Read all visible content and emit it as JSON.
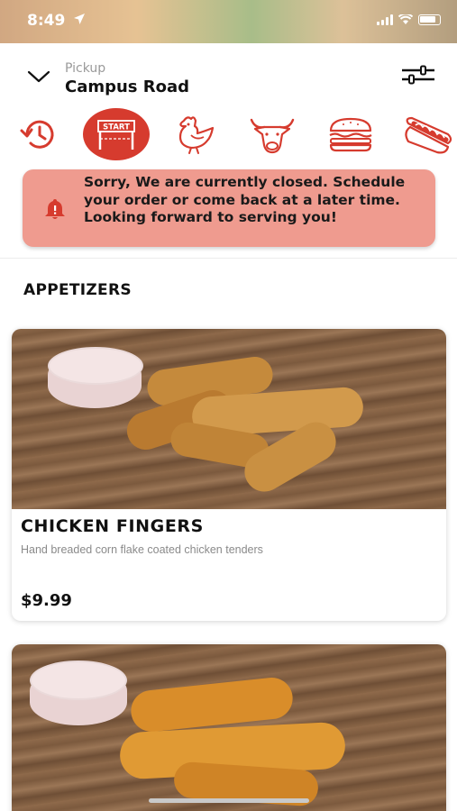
{
  "status_bar": {
    "time": "8:49"
  },
  "header": {
    "mode_label": "Pickup",
    "location": "Campus Road"
  },
  "categories": [
    {
      "icon": "history-icon"
    },
    {
      "icon": "start-icon",
      "label": "START",
      "active": true
    },
    {
      "icon": "chicken-icon"
    },
    {
      "icon": "bull-icon"
    },
    {
      "icon": "burger-icon"
    },
    {
      "icon": "hotdog-icon"
    }
  ],
  "banner": {
    "message": "Sorry, We are currently closed. Schedule your order or come back at a later time. Looking forward to serving you!",
    "color": "#ef9b8f"
  },
  "section": {
    "title": "APPETIZERS"
  },
  "items": [
    {
      "name": "CHICKEN FINGERS",
      "description": "Hand breaded corn flake coated chicken  tenders",
      "price": "$9.99"
    },
    {
      "name": "",
      "description": "",
      "price": ""
    }
  ],
  "colors": {
    "accent": "#d63b2e",
    "banner": "#ef9b8f"
  }
}
